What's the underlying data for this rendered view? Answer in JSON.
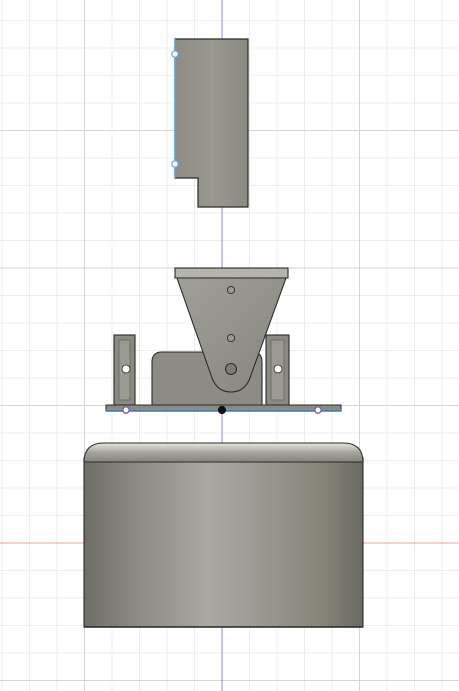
{
  "app": {
    "view": "cad-canvas-front-orthographic"
  },
  "canvas": {
    "background": "#ffffff",
    "grid_minor_color": "#ececec",
    "grid_major_color": "#d6d6d6",
    "axis_vertical_color": "#8c8ce6",
    "axis_horizontal_color": "#f0a0a0"
  },
  "model": {
    "body_color": "#8e8e86",
    "body_dark": "#5a5a52",
    "body_light": "#c4c4bc",
    "edge_color": "#2a2a2a",
    "sketch_line_color": "#5aa9e6",
    "sketch_point_color": "#7b5db0",
    "parts": [
      {
        "name": "top-bracket-plate"
      },
      {
        "name": "triangular-hinge-bracket"
      },
      {
        "name": "left-clamp-post"
      },
      {
        "name": "right-clamp-post"
      },
      {
        "name": "center-block"
      },
      {
        "name": "base-plate"
      },
      {
        "name": "cylindrical-base"
      }
    ]
  }
}
